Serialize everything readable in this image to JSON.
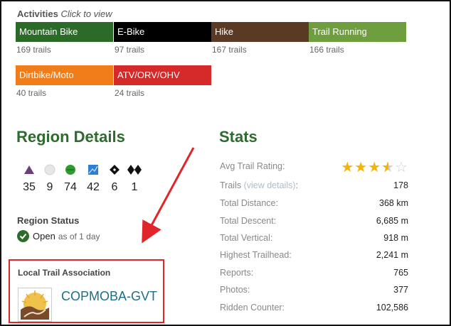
{
  "activities": {
    "title": "Activities",
    "hint": "Click to view",
    "items": [
      {
        "name": "Mountain Bike",
        "count": "169 trails",
        "color": "#2c6b27"
      },
      {
        "name": "E-Bike",
        "count": "97 trails",
        "color": "#000000"
      },
      {
        "name": "Hike",
        "count": "167 trails",
        "color": "#5a3a24"
      },
      {
        "name": "Trail Running",
        "count": "166 trails",
        "color": "#6f9e3f"
      },
      {
        "name": "Dirtbike/Moto",
        "count": "40 trails",
        "color": "#f07d1a"
      },
      {
        "name": "ATV/ORV/OHV",
        "count": "24 trails",
        "color": "#d42a2a"
      }
    ]
  },
  "region_details": {
    "title": "Region Details",
    "difficulty": [
      {
        "icon": "purple-triangle-icon",
        "count": "35"
      },
      {
        "icon": "white-circle-icon",
        "count": "9"
      },
      {
        "icon": "green-circle-icon",
        "count": "74"
      },
      {
        "icon": "blue-square-icon",
        "count": "42"
      },
      {
        "icon": "black-diamond-icon",
        "count": "6"
      },
      {
        "icon": "double-black-diamond-icon",
        "count": "1"
      }
    ],
    "status_label": "Region Status",
    "status": "Open",
    "status_asof": "as of 1 day"
  },
  "association": {
    "label": "Local Trail Association",
    "name": "COPMOBA-GVT"
  },
  "stats": {
    "title": "Stats",
    "rating_label": "Avg Trail Rating:",
    "rating": 3.5,
    "trails_label": "Trails",
    "trails_link": "(view details)",
    "trails_colon": ":",
    "rows": [
      {
        "label": "Total Distance:",
        "value": "368 km"
      },
      {
        "label": "Total Descent:",
        "value": "6,685 m"
      },
      {
        "label": "Total Vertical:",
        "value": "918 m"
      },
      {
        "label": "Highest Trailhead:",
        "value": "2,241 m"
      },
      {
        "label": "Reports:",
        "value": "765"
      },
      {
        "label": "Photos:",
        "value": "377"
      },
      {
        "label": "Ridden Counter:",
        "value": "102,586"
      }
    ],
    "trails_value": "178"
  },
  "annotation": {
    "color": "#e0262a"
  }
}
